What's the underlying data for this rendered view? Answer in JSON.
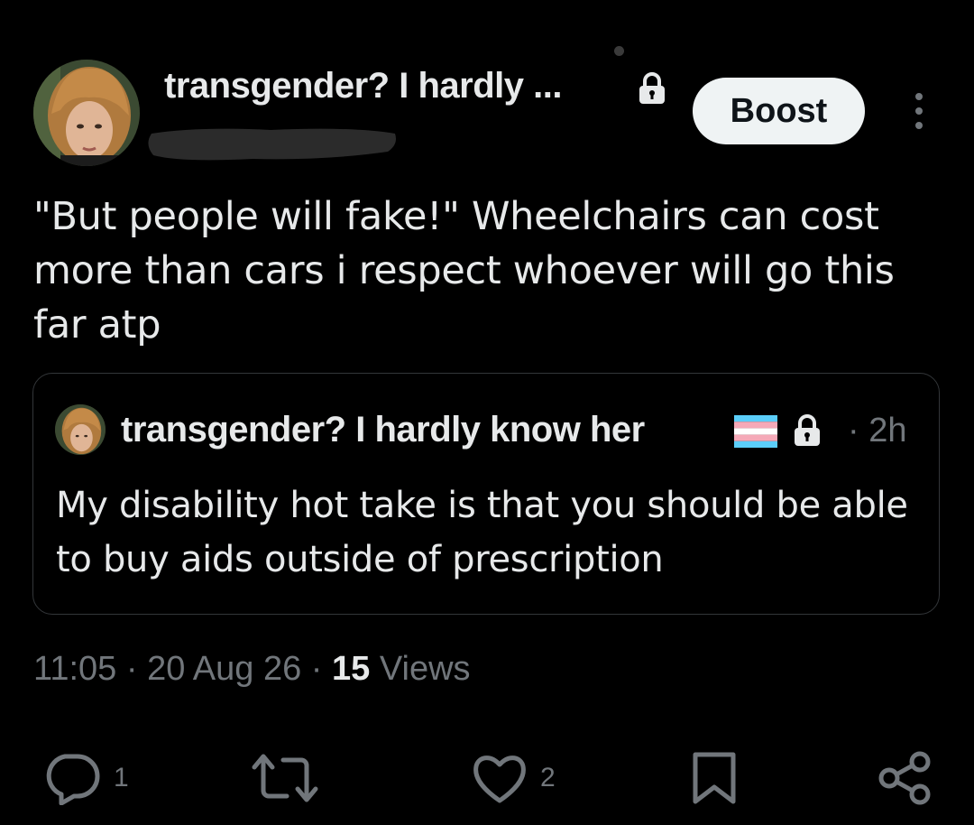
{
  "post": {
    "display_name": "transgender? I hardly ...",
    "boost_label": "Boost",
    "text": "\"But people will fake!\" Wheelchairs can cost more than cars i respect whoever will go this far atp"
  },
  "quote": {
    "display_name": "transgender? I hardly know her",
    "time": "· 2h",
    "text": "My disability hot take is that you should be able to buy aids outside of prescription"
  },
  "meta": {
    "time": "11:05",
    "sep1": "·",
    "date": "20 Aug 26",
    "sep2": "·",
    "views_count": "15",
    "views_label": "Views"
  },
  "actions": {
    "reply_count": "1",
    "like_count": "2"
  },
  "colors": {
    "background": "#000000",
    "text": "#e7e9ea",
    "muted": "#71767b",
    "border": "#333639",
    "button_bg": "#eff3f4"
  },
  "icons": [
    "lock-icon",
    "more-icon",
    "trans-flag-icon",
    "reply-icon",
    "repost-icon",
    "like-icon",
    "bookmark-icon",
    "share-icon"
  ]
}
